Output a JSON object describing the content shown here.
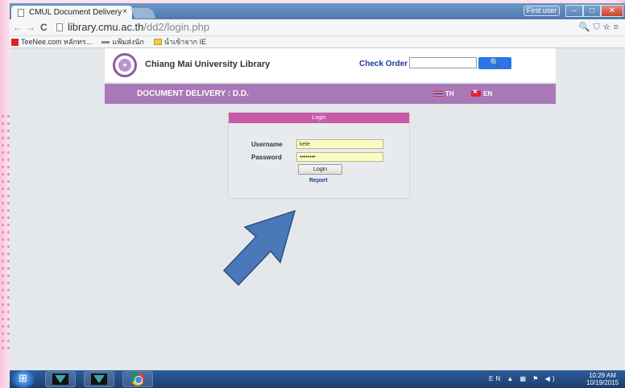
{
  "browser": {
    "tab_title": "CMUL Document Delivery",
    "tab_close": "×",
    "profile_button": "First user",
    "address": {
      "host": "library.cmu.ac.th",
      "path": "/dd2/login.php"
    },
    "bookmarks": [
      "TeeNee.com หลักทร...",
      "แฟ้มส่งนัก",
      "นำเข้าจาก IE"
    ]
  },
  "site": {
    "title": "Chiang Mai University Library",
    "check_order_label": "Check Order",
    "check_order_value": "",
    "search_icon": "search-icon",
    "banner": "DOCUMENT DELIVERY : D.D.",
    "languages": [
      "TH",
      "EN"
    ]
  },
  "login": {
    "header": "Login",
    "username_label": "Username",
    "username_value": "kele",
    "password_label": "Password",
    "password_value": "••••••••",
    "login_button": "Login",
    "report_link": "Report"
  },
  "taskbar": {
    "language": "EN",
    "time": "10:29 AM",
    "date": "10/19/2015"
  },
  "colors": {
    "accent_purple": "#a978b6",
    "login_header": "#c95aa9",
    "arrow": "#4a78b8"
  }
}
